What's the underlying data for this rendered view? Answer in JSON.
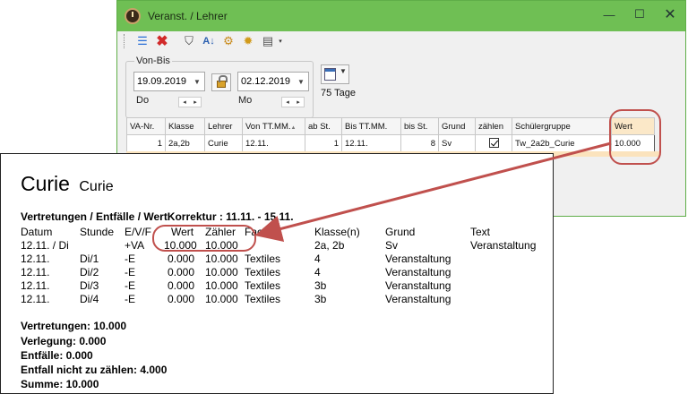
{
  "window": {
    "title": "Veranst. / Lehrer",
    "controls": {
      "minimize": "—",
      "maximize": "☐",
      "close": "✕"
    }
  },
  "toolbar": {
    "icons": [
      "list-icon",
      "delete-icon",
      "filter-icon",
      "sort-icon",
      "settings-icon",
      "gear-icon",
      "clipboard-icon",
      "dropdown-arrow-icon"
    ]
  },
  "date_range": {
    "group_label": "Von-Bis",
    "from_date": "19.09.2019",
    "from_weekday": "Do",
    "to_date": "02.12.2019",
    "to_weekday": "Mo",
    "days": "75 Tage",
    "spinner_left": "◂",
    "spinner_right": "▸",
    "dropdown": "▼"
  },
  "table": {
    "columns": [
      "VA-Nr.",
      "Klasse",
      "Lehrer",
      "Von TT.MM.",
      "ab St.",
      "Bis TT.MM.",
      "bis St.",
      "Grund",
      "zählen",
      "Schülergruppe",
      "Wert"
    ],
    "rows": [
      {
        "va_nr": "1",
        "klasse": "2a,2b",
        "lehrer": "Curie",
        "von": "12.11.",
        "ab_st": "1",
        "bis": "12.11.",
        "bis_st": "8",
        "grund": "Sv",
        "zaehlen": true,
        "schuelergruppe": "Tw_2a2b_Curie",
        "wert": "10.000"
      }
    ]
  },
  "report": {
    "name": "Curie",
    "short_name": "Curie",
    "subtitle": "Vertretungen / Entfälle / WertKorrektur : 11.11. - 15.11.",
    "columns": [
      "Datum",
      "Stunde",
      "E/V/F",
      "Wert",
      "Zähler",
      "Fach",
      "Klasse(n)",
      "Grund",
      "Text"
    ],
    "rows": [
      {
        "datum": "12.11. / Di",
        "stunde": "",
        "evf": "+VA",
        "wert": "10.000",
        "zaehler": "10.000",
        "fach": "",
        "klassen": "2a, 2b",
        "grund": "Sv",
        "text": "Veranstaltung"
      },
      {
        "datum": "12.11.",
        "stunde": "Di/1",
        "evf": "-E",
        "wert": "0.000",
        "zaehler": "10.000",
        "fach": "Textiles",
        "klassen": "4",
        "grund": "Veranstaltung",
        "text": ""
      },
      {
        "datum": "12.11.",
        "stunde": "Di/2",
        "evf": "-E",
        "wert": "0.000",
        "zaehler": "10.000",
        "fach": "Textiles",
        "klassen": "4",
        "grund": "Veranstaltung",
        "text": ""
      },
      {
        "datum": "12.11.",
        "stunde": "Di/3",
        "evf": "-E",
        "wert": "0.000",
        "zaehler": "10.000",
        "fach": "Textiles",
        "klassen": "3b",
        "grund": "Veranstaltung",
        "text": ""
      },
      {
        "datum": "12.11.",
        "stunde": "Di/4",
        "evf": "-E",
        "wert": "0.000",
        "zaehler": "10.000",
        "fach": "Textiles",
        "klassen": "3b",
        "grund": "Veranstaltung",
        "text": ""
      }
    ],
    "summary": [
      "Vertretungen: 10.000",
      "Verlegung: 0.000",
      "Entfälle: 0.000",
      "Entfall nicht zu zählen: 4.000",
      "Summe: 10.000"
    ]
  },
  "colors": {
    "titlebar": "#6fbf54",
    "annotation": "#c0504d",
    "highlight": "#fbe3bd"
  }
}
